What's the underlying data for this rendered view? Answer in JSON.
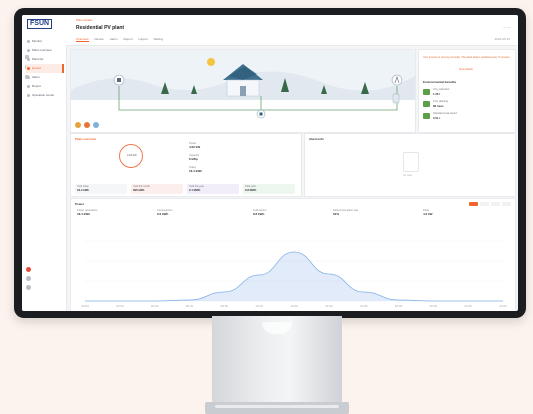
{
  "header": {
    "logo": "FSUN",
    "crumb": "Plant details",
    "title": "Residential PV plant",
    "tabs": [
      "Overview",
      "Device",
      "Alarm",
      "Report",
      "Layout",
      "Setting"
    ],
    "right": "— —",
    "date": "2024-06-15"
  },
  "sidebar": {
    "items": [
      "Monitor",
      "Plant overview",
      "Plant list",
      "Device",
      "Alarm",
      "Report",
      "Operation center"
    ],
    "active_index": 3
  },
  "right_panel": {
    "note": "Your inverter is running normally. The plant data is updated every 5 minutes.",
    "link": "View details",
    "title": "Environmental benefits",
    "rows": [
      {
        "label": "CO₂ reduction",
        "value": "1.26 t"
      },
      {
        "label": "Tree planting",
        "value": "68 trees"
      },
      {
        "label": "Standard coal saved",
        "value": "0.51 t"
      }
    ]
  },
  "overview": {
    "title": "Plant overview",
    "ring_value": "4.62 kW",
    "kv": [
      {
        "label": "Power",
        "value": "4.62 kW"
      },
      {
        "label": "Capacity",
        "value": "6 kWp"
      },
      {
        "label": "Today",
        "value": "18.4 kWh"
      }
    ],
    "stats": [
      {
        "label": "Yield today",
        "value": "18.4 kWh"
      },
      {
        "label": "Yield this month",
        "value": "296 kWh"
      },
      {
        "label": "Yield this year",
        "value": "2.1 MWh"
      },
      {
        "label": "Total yield",
        "value": "9.8 MWh"
      }
    ]
  },
  "alarm": {
    "title": "Alarm info",
    "empty": "No data"
  },
  "power_card": {
    "title": "Power",
    "stats": [
      {
        "label": "Power generation",
        "value": "18.4 kWh"
      },
      {
        "label": "Consumption",
        "value": "9.6 kWh"
      },
      {
        "label": "Grid feed-in",
        "value": "8.8 kWh"
      },
      {
        "label": "Self-consumption rate",
        "value": "52%"
      },
      {
        "label": "Peak",
        "value": "4.9 kW"
      }
    ],
    "tools": [
      "Day",
      "Month",
      "Year",
      "Total"
    ]
  },
  "chart_data": {
    "type": "area",
    "title": "Power",
    "xlabel": "",
    "ylabel": "",
    "x": [
      "00:00",
      "02:00",
      "04:00",
      "06:00",
      "08:00",
      "10:00",
      "12:00",
      "14:00",
      "16:00",
      "18:00",
      "20:00",
      "22:00",
      "24:00"
    ],
    "values": [
      0,
      0,
      0,
      0.1,
      0.9,
      2.6,
      4.9,
      2.7,
      0.9,
      0.1,
      0,
      0,
      0
    ],
    "ylim": [
      0,
      6
    ],
    "grid": true,
    "color": "#a8c7f0"
  },
  "colors": {
    "accent": "#f0652b",
    "brand": "#1f3d8a",
    "line": "#6aa36f"
  }
}
